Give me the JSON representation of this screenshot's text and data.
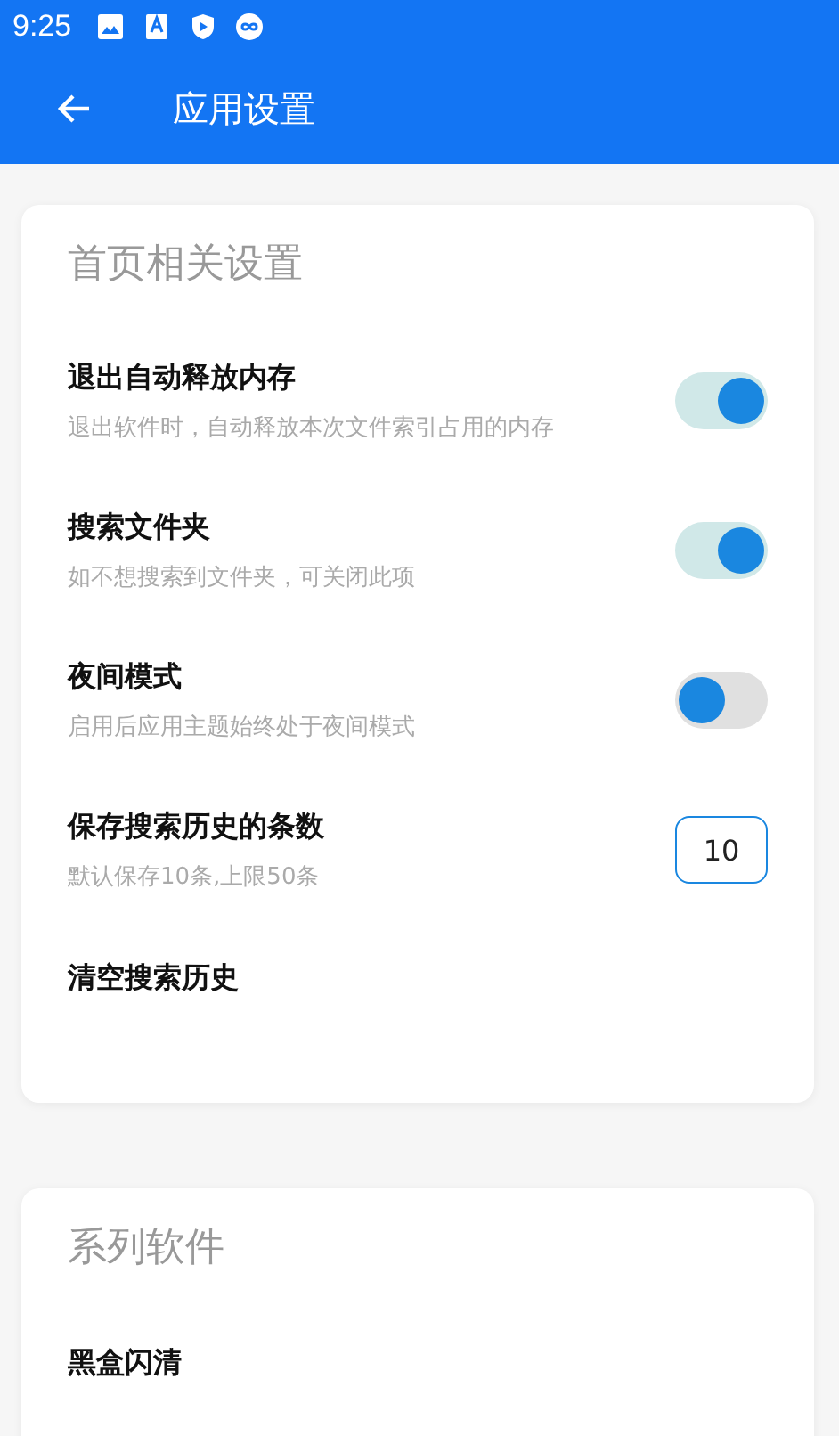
{
  "status_bar": {
    "time": "9:25"
  },
  "toolbar": {
    "title": "应用设置"
  },
  "sections": [
    {
      "title": "首页相关设置",
      "items": [
        {
          "kind": "toggle",
          "title": "退出自动释放内存",
          "subtitle": "退出软件时，自动释放本次文件索引占用的内存",
          "on": true
        },
        {
          "kind": "toggle",
          "title": "搜索文件夹",
          "subtitle": "如不想搜索到文件夹，可关闭此项",
          "on": true
        },
        {
          "kind": "toggle",
          "title": "夜间模式",
          "subtitle": "启用后应用主题始终处于夜间模式",
          "on": false
        },
        {
          "kind": "number",
          "title": "保存搜索历史的条数",
          "subtitle": "默认保存10条,上限50条",
          "value": "10"
        },
        {
          "kind": "action",
          "title": "清空搜索历史"
        }
      ]
    },
    {
      "title": "系列软件",
      "items": [
        {
          "kind": "action",
          "title": "黑盒闪清"
        }
      ]
    }
  ]
}
